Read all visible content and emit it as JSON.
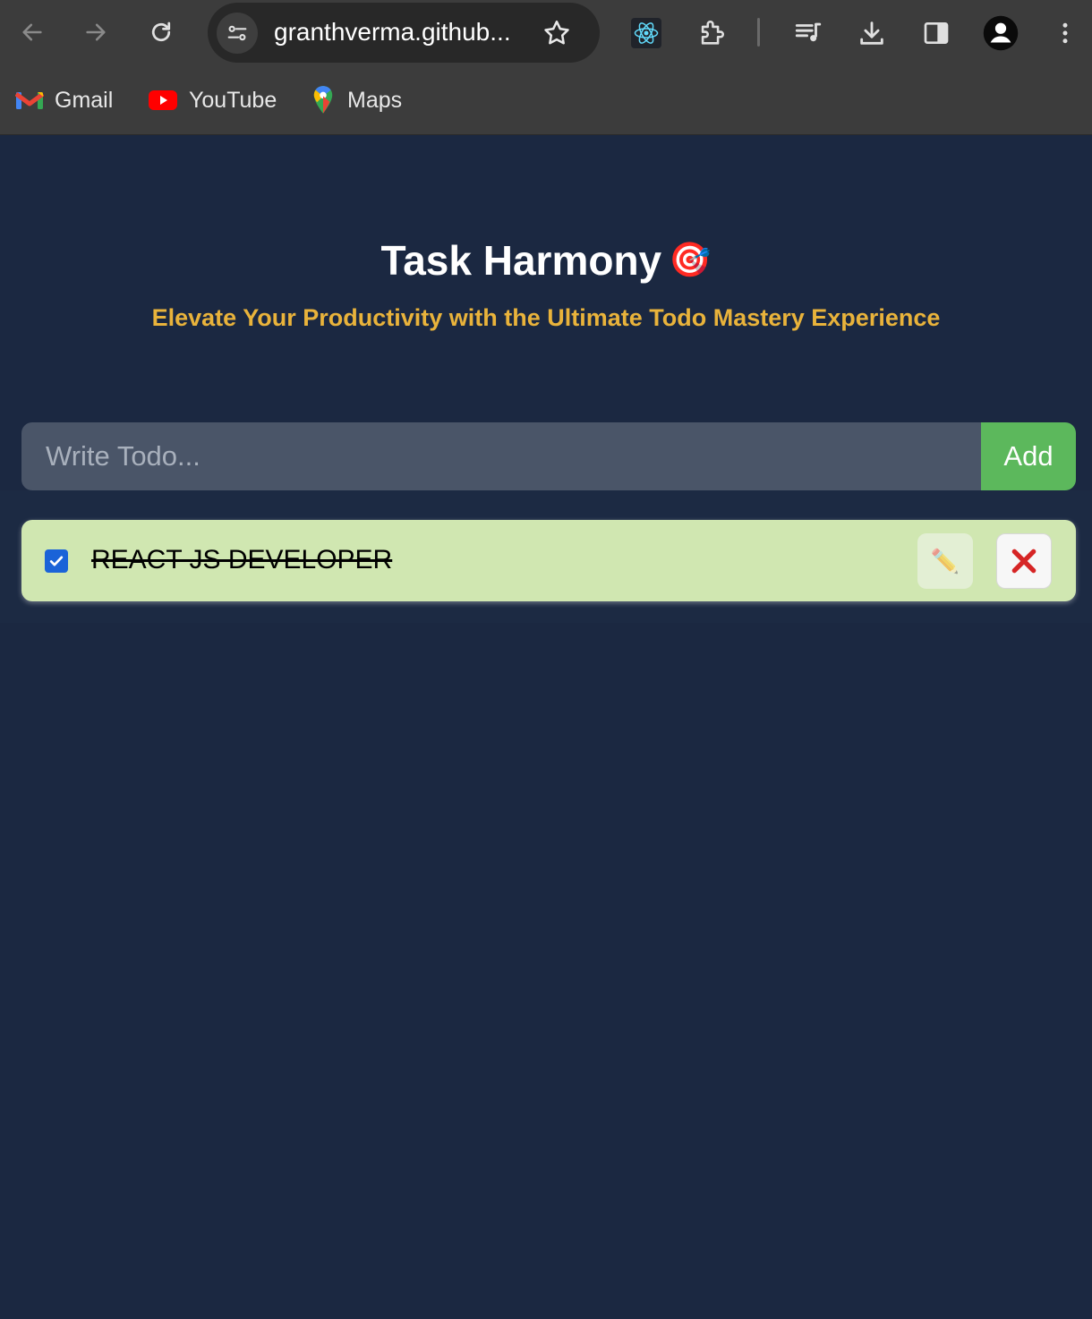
{
  "browser": {
    "url": "granthverma.github...",
    "bookmarks": [
      {
        "label": "Gmail",
        "icon": "gmail-icon"
      },
      {
        "label": "YouTube",
        "icon": "youtube-icon"
      },
      {
        "label": "Maps",
        "icon": "maps-icon"
      }
    ]
  },
  "app": {
    "title": "Task Harmony",
    "title_emoji": "🎯",
    "subtitle": "Elevate Your Productivity with the Ultimate Todo Mastery Experience",
    "input_placeholder": "Write Todo...",
    "add_label": "Add"
  },
  "todos": [
    {
      "text": "REACT JS DEVELOPER",
      "completed": true,
      "edit_icon": "✏️",
      "delete_icon": "❌"
    }
  ],
  "colors": {
    "background": "#1b2841",
    "subtitle": "#e9b33b",
    "input_bg": "#4a5568",
    "add_button": "#5cb85c",
    "todo_bg": "#d0e7b1",
    "checkbox": "#1a63d8"
  }
}
